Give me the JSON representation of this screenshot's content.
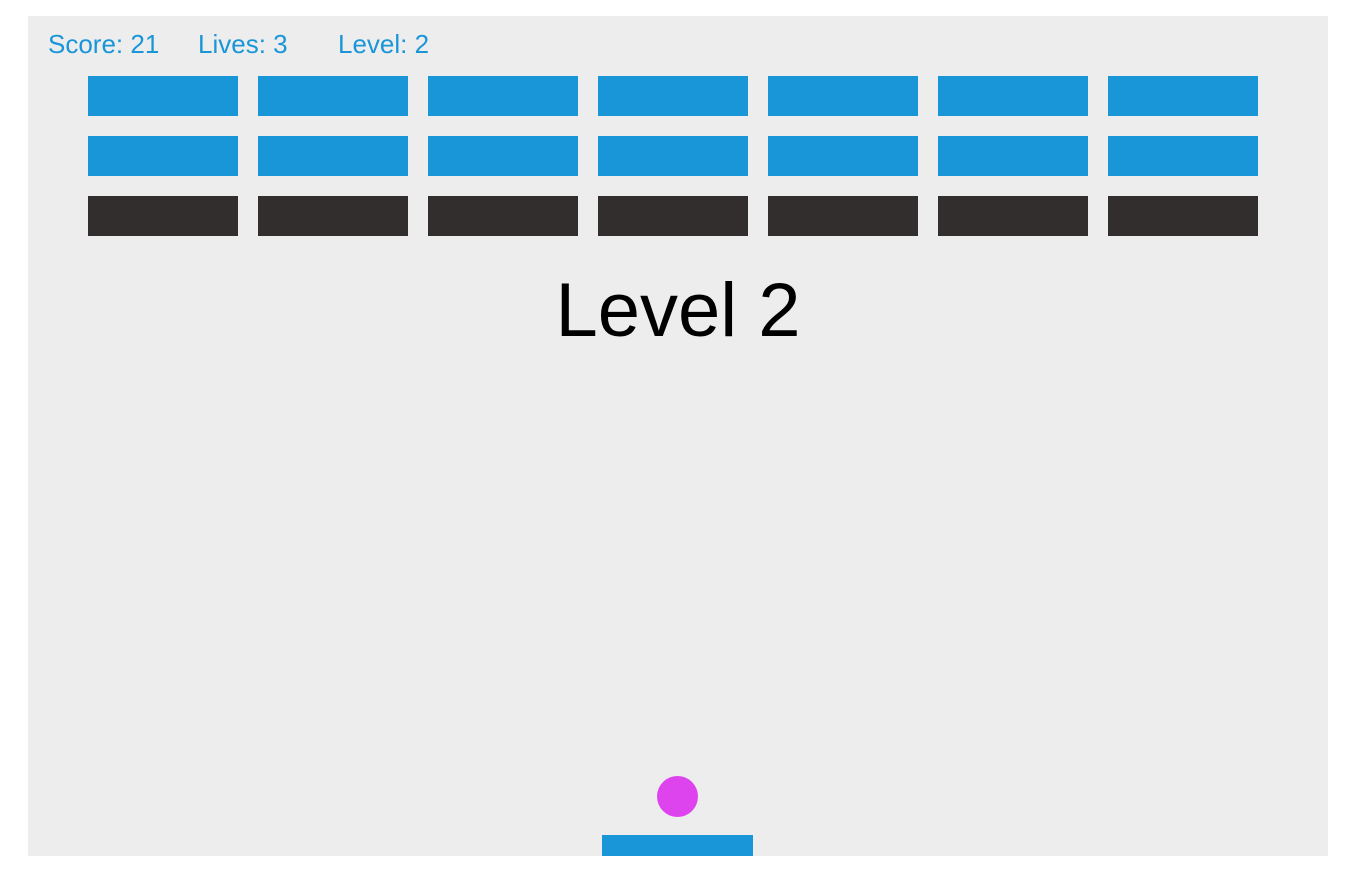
{
  "hud": {
    "score": "Score: 21",
    "lives": "Lives: 3",
    "level": "Level: 2"
  },
  "banner": {
    "text": "Level 2"
  },
  "colors": {
    "background": "#ededed",
    "hud_text": "#1a96d8",
    "brick_blue": "#1896d8",
    "brick_dark": "#332e2e",
    "ball": "#dd44ee",
    "paddle": "#1896d8"
  },
  "bricks": {
    "rows": [
      {
        "color": "brick_blue",
        "count": 7
      },
      {
        "color": "brick_blue",
        "count": 7
      },
      {
        "color": "brick_dark",
        "count": 7
      }
    ]
  }
}
